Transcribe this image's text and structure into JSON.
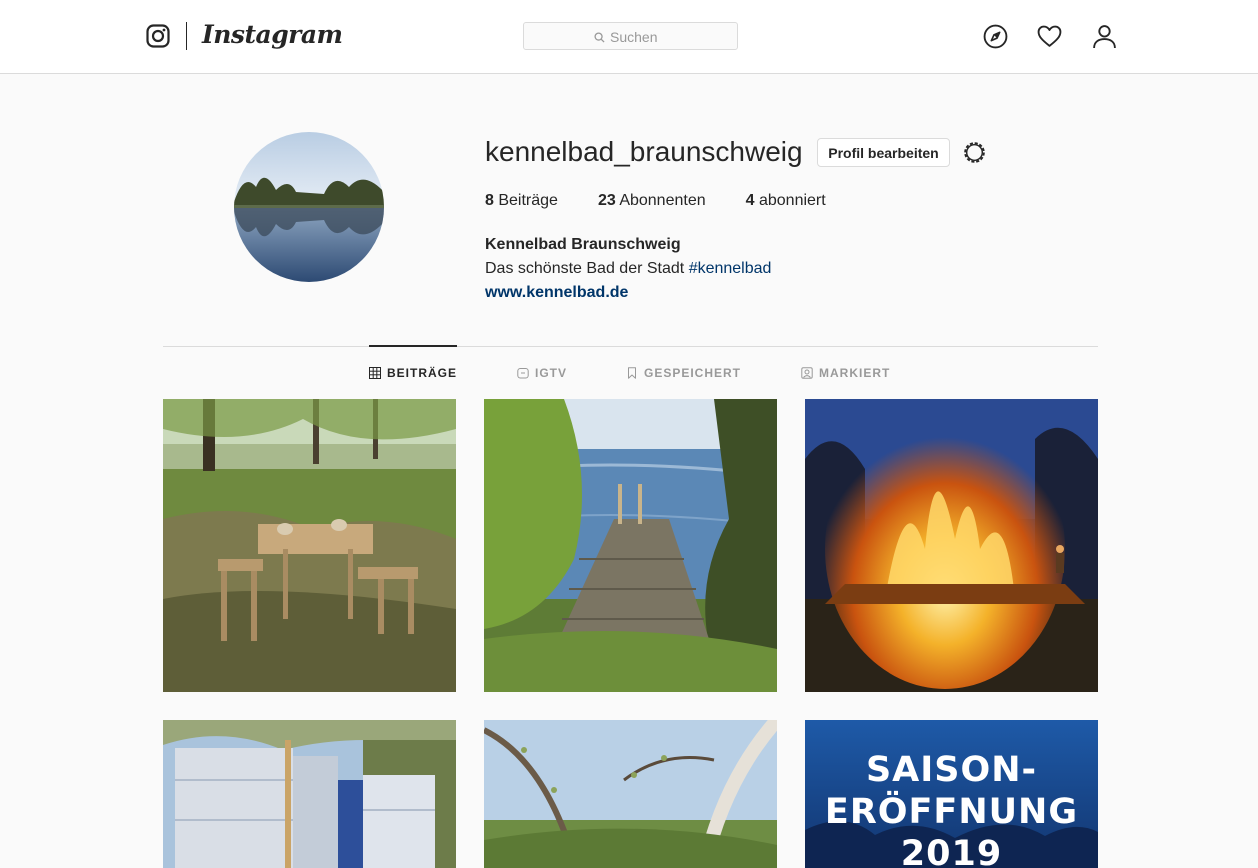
{
  "nav": {
    "logo_text": "Instagram",
    "search_placeholder": "Suchen"
  },
  "profile": {
    "username": "kennelbad_braunschweig",
    "edit_button": "Profil bearbeiten",
    "stats": [
      {
        "count": "8",
        "label": "Beiträge"
      },
      {
        "count": "23",
        "label": "Abonnenten"
      },
      {
        "count": "4",
        "label": "abonniert"
      }
    ],
    "bio": {
      "name": "Kennelbad Braunschweig",
      "text": "Das schönste Bad der Stadt",
      "hashtag": "#kennelbad",
      "link": "www.kennelbad.de"
    }
  },
  "tabs": [
    {
      "label": "BEITRÄGE",
      "icon": "grid-icon",
      "active": true
    },
    {
      "label": "IGTV",
      "icon": "tv-icon",
      "active": false
    },
    {
      "label": "GESPEICHERT",
      "icon": "bookmark-icon",
      "active": false
    },
    {
      "label": "MARKIERT",
      "icon": "tagged-icon",
      "active": false
    }
  ],
  "posts": {
    "poster": {
      "line1": "SAISON-",
      "line2": "ERÖFFNUNG",
      "line3": "2019"
    }
  }
}
